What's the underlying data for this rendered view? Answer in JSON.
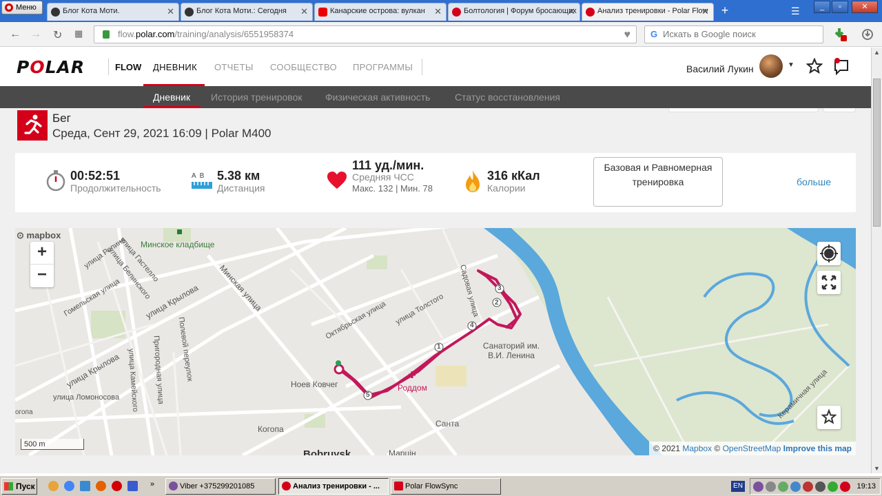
{
  "browser": {
    "menu_label": "Меню",
    "tabs": [
      {
        "title": "Блог Кота Моти.",
        "icon_color": "#444"
      },
      {
        "title": "Блог Кота Моти.: Сегодня",
        "icon_color": "#444"
      },
      {
        "title": "Канарские острова: вулкан",
        "icon_color": "#e00"
      },
      {
        "title": "Болтология | Форум бросающих",
        "icon_color": "#d4001a"
      },
      {
        "title": "Анализ тренировки - Polar Flow",
        "icon_color": "#d4001a"
      }
    ],
    "url_prefix": "flow.",
    "url_domain": "polar.com",
    "url_path": "/training/analysis/6551958374",
    "search_placeholder": "Искать в Google поиск",
    "search_engine_letter": "G"
  },
  "header": {
    "logo": "POLAR",
    "brand": "FLOW",
    "nav": [
      "ДНЕВНИК",
      "ОТЧЕТЫ",
      "СООБЩЕСТВО",
      "ПРОГРАММЫ"
    ],
    "user_name": "Василий Лукин"
  },
  "subnav": [
    "Дневник",
    "История тренировок",
    "Физическая активность",
    "Статус восстановления"
  ],
  "session": {
    "sport": "Бег",
    "datetime": "Среда, Сент 29, 2021 16:09 | Polar M400"
  },
  "summary": {
    "duration_value": "00:52:51",
    "duration_label": "Продолжительность",
    "distance_value": "5.38 км",
    "distance_label": "Дистанция",
    "distance_ab": "A  B",
    "hr_value": "111 уд./мин.",
    "hr_label": "Средняя ЧСС",
    "hr_sub": "Макс. 132 | Мин. 78",
    "calories_value": "316 кКал",
    "calories_label": "Калории",
    "training_type": "Базовая и Равномерная тренировка",
    "more_label": "больше"
  },
  "map": {
    "provider": "mapbox",
    "scale_label": "500 m",
    "attribution_copy": "© 2021",
    "attribution_mapbox": "Mapbox",
    "attribution_osm": "OpenStreetMap",
    "attribution_improve": "Improve this map",
    "copyright_sign": "©",
    "zoom_in": "+",
    "zoom_out": "−",
    "labels": [
      "Минское кладбище",
      "улица Репина",
      "улица Гастелло",
      "улица Белинского",
      "Гомельская улица",
      "улица Крылова",
      "Минская улица",
      "Полевой переулок",
      "Пригородная улица",
      "улица Камейского",
      "улица Ломоносова",
      "Октябрьская улица",
      "улица Толстого",
      "Садовая улица",
      "Санаторий им. В.И. Ленина",
      "Ноев Ковчег",
      "Роддом",
      "Санта",
      "Когопа",
      "Марцін",
      "Bobruysk",
      "Керамичная улица",
      "улица Крылова",
      "огопа"
    ],
    "lap_markers": [
      "1",
      "2",
      "3",
      "4",
      "5"
    ],
    "route_color": "#c2185b"
  },
  "taskbar": {
    "start_label": "Пуск",
    "items": [
      {
        "label": "Viber +375299201085",
        "icon_color": "#7b519d"
      },
      {
        "label": "Анализ тренировки - ...",
        "icon_color": "#d4001a"
      },
      {
        "label": "Polar FlowSync",
        "icon_color": "#d4001a"
      }
    ],
    "lang": "EN",
    "clock": "19:13"
  }
}
